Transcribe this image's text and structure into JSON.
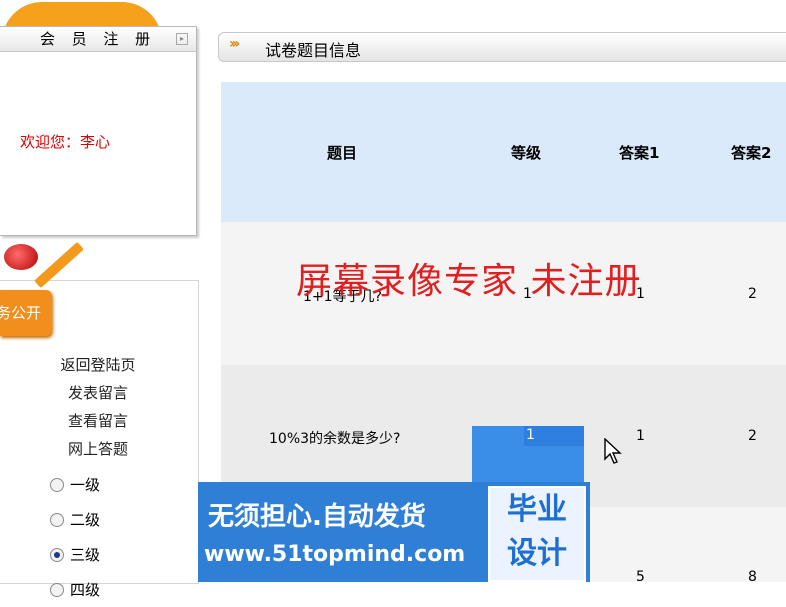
{
  "sidebar": {
    "member_box_title": "会 员 注 册",
    "welcome_text": "欢迎您：李心",
    "orange_tab_label": "务公开",
    "links": [
      "返回登陆页",
      "发表留言",
      "查看留言",
      "网上答题"
    ],
    "levels": [
      {
        "label": "一级",
        "checked": false
      },
      {
        "label": "二级",
        "checked": false
      },
      {
        "label": "三级",
        "checked": true
      },
      {
        "label": "四级",
        "checked": false
      }
    ]
  },
  "main": {
    "title_chevrons": "›››",
    "title": "试卷题目信息",
    "columns": [
      "题目",
      "等级",
      "答案1",
      "答案2"
    ],
    "rows": [
      {
        "question": "1+1等于几?",
        "level": "1",
        "answer1": "1",
        "answer2": "2"
      },
      {
        "question": "10%3的余数是多少?",
        "level": "1",
        "answer1": "1",
        "answer2": "2"
      },
      {
        "question": "",
        "level": "",
        "answer1": "5",
        "answer2": "8"
      }
    ]
  },
  "overlay": {
    "watermark": "屏幕录像专家  未注册"
  },
  "ad": {
    "line1": "无须担心.自动发货",
    "line2": "www.51topmind.com",
    "box_line1": "毕业",
    "box_line2": "设计"
  },
  "colors": {
    "accent_orange": "#f28e1c",
    "header_blue": "#dbeafb",
    "welcome_red": "#e00000",
    "ad_blue": "#2f7fd6"
  }
}
